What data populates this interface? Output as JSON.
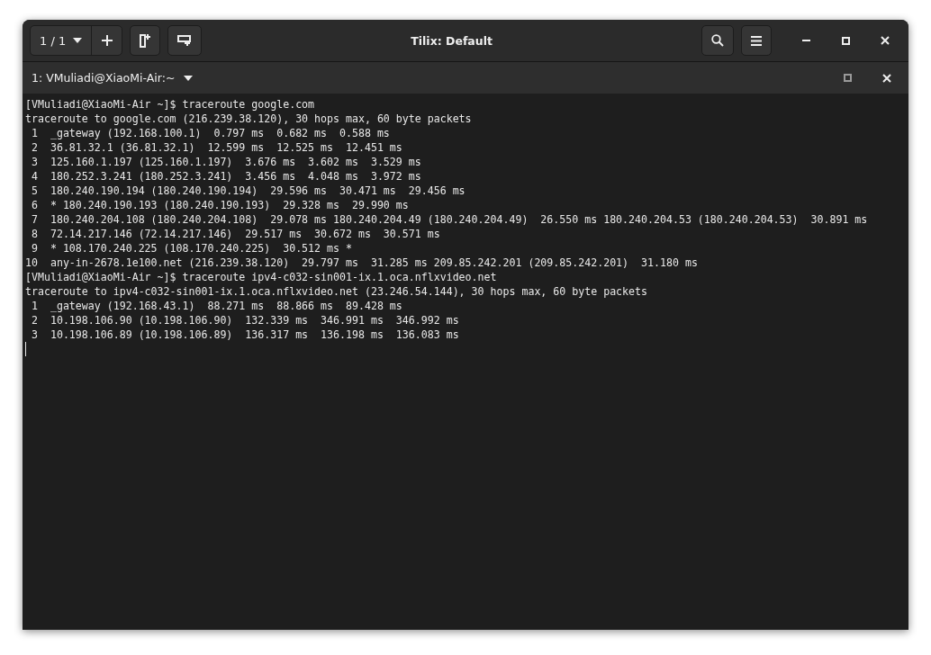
{
  "window": {
    "title": "Tilix: Default",
    "session_switcher": "1 / 1"
  },
  "terminal_tab": {
    "title": "1: VMuliadi@XiaoMi-Air:~"
  },
  "terminal": {
    "lines": [
      "[VMuliadi@XiaoMi-Air ~]$ traceroute google.com",
      "traceroute to google.com (216.239.38.120), 30 hops max, 60 byte packets",
      " 1  _gateway (192.168.100.1)  0.797 ms  0.682 ms  0.588 ms",
      " 2  36.81.32.1 (36.81.32.1)  12.599 ms  12.525 ms  12.451 ms",
      " 3  125.160.1.197 (125.160.1.197)  3.676 ms  3.602 ms  3.529 ms",
      " 4  180.252.3.241 (180.252.3.241)  3.456 ms  4.048 ms  3.972 ms",
      " 5  180.240.190.194 (180.240.190.194)  29.596 ms  30.471 ms  29.456 ms",
      " 6  * 180.240.190.193 (180.240.190.193)  29.328 ms  29.990 ms",
      " 7  180.240.204.108 (180.240.204.108)  29.078 ms 180.240.204.49 (180.240.204.49)  26.550 ms 180.240.204.53 (180.240.204.53)  30.891 ms",
      " 8  72.14.217.146 (72.14.217.146)  29.517 ms  30.672 ms  30.571 ms",
      " 9  * 108.170.240.225 (108.170.240.225)  30.512 ms *",
      "10  any-in-2678.1e100.net (216.239.38.120)  29.797 ms  31.285 ms 209.85.242.201 (209.85.242.201)  31.180 ms",
      "[VMuliadi@XiaoMi-Air ~]$ traceroute ipv4-c032-sin001-ix.1.oca.nflxvideo.net",
      "traceroute to ipv4-c032-sin001-ix.1.oca.nflxvideo.net (23.246.54.144), 30 hops max, 60 byte packets",
      " 1  _gateway (192.168.43.1)  88.271 ms  88.866 ms  89.428 ms",
      " 2  10.198.106.90 (10.198.106.90)  132.339 ms  346.991 ms  346.992 ms",
      " 3  10.198.106.89 (10.198.106.89)  136.317 ms  136.198 ms  136.083 ms"
    ]
  }
}
